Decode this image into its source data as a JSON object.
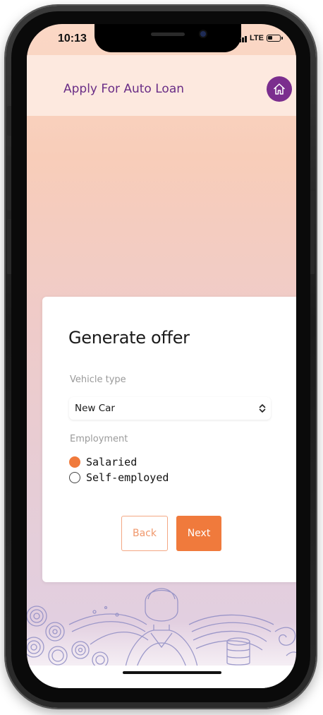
{
  "status_bar": {
    "time": "10:13",
    "network": "LTE",
    "signal_icon": "signal-bars-icon",
    "battery_icon": "battery-icon"
  },
  "header": {
    "title": "Apply For Auto Loan",
    "home_icon": "home-icon",
    "accent_color": "#7b2e8e"
  },
  "form": {
    "title": "Generate offer",
    "vehicle_type_label": "Vehicle type",
    "vehicle_type_value": "New Car",
    "employment_label": "Employment",
    "employment_options": [
      {
        "label": "Salaried",
        "checked": true
      },
      {
        "label": "Self-employed",
        "checked": false
      }
    ],
    "back_label": "Back",
    "next_label": "Next",
    "primary_color": "#f07a3c"
  }
}
